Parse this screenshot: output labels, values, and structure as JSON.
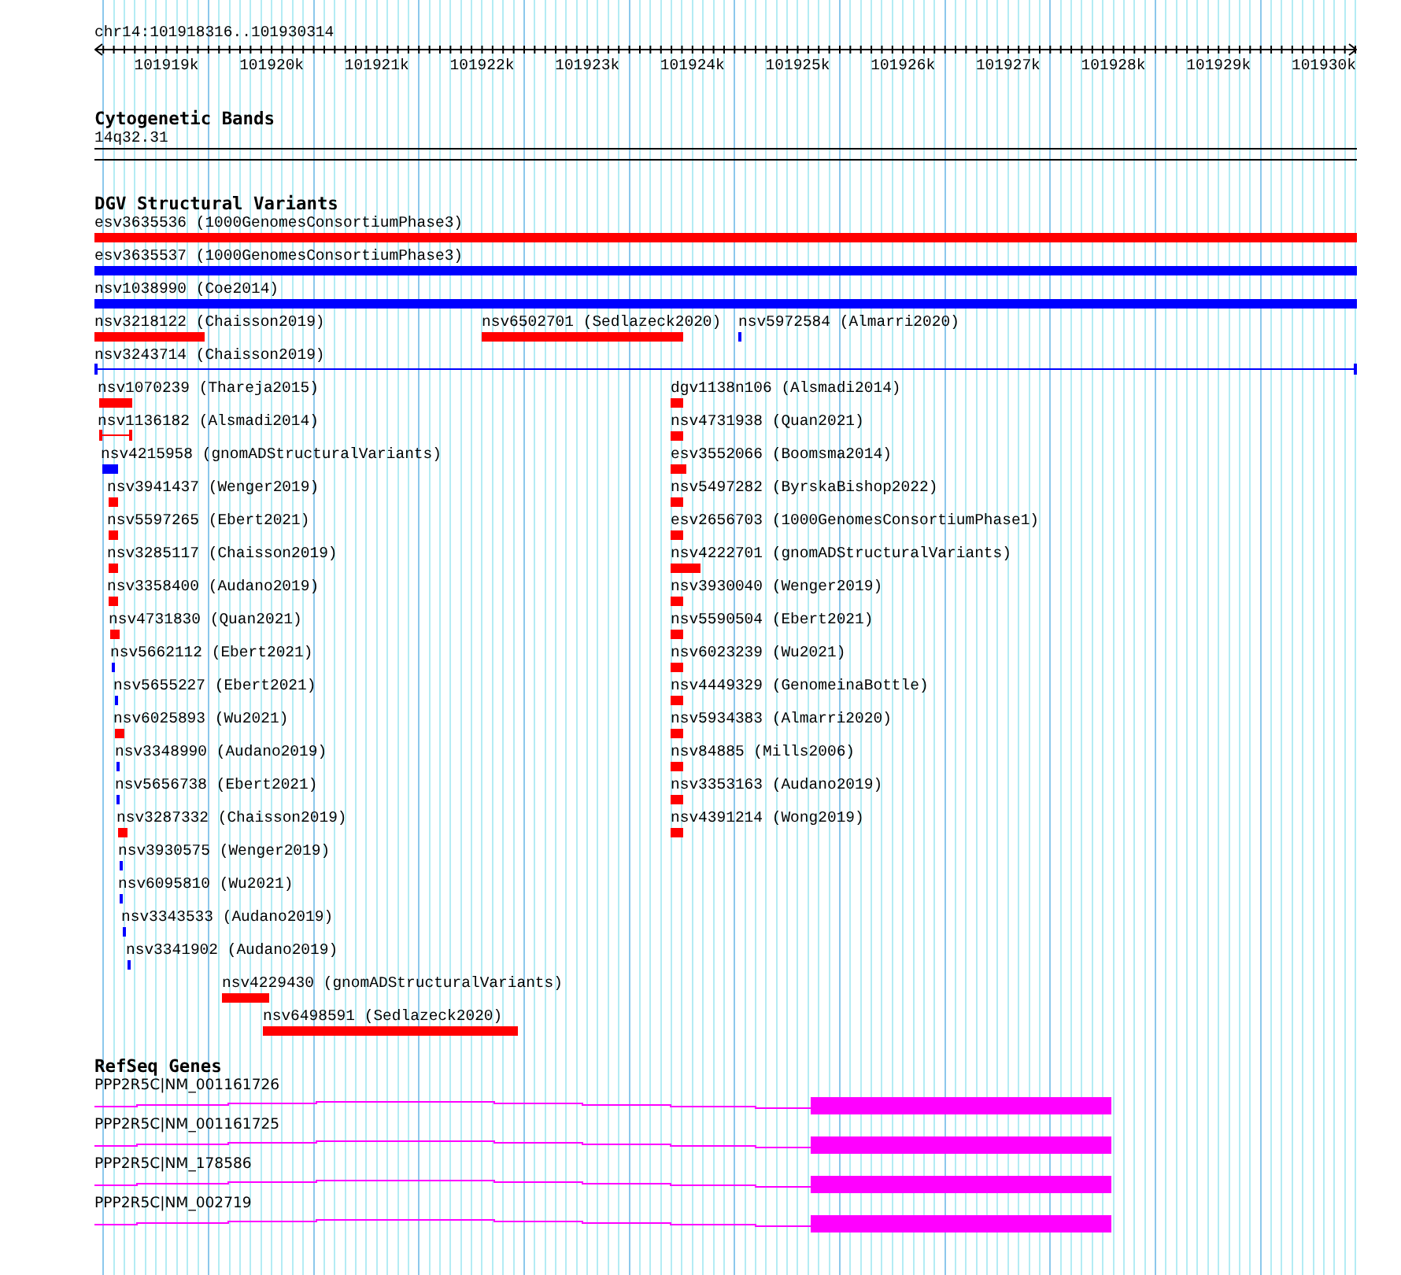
{
  "location": "chr14:101918316..101930314",
  "ruler": {
    "ticks": [
      "101919k",
      "101920k",
      "101921k",
      "101922k",
      "101923k",
      "101924k",
      "101925k",
      "101926k",
      "101927k",
      "101928k",
      "101929k",
      "101930k"
    ]
  },
  "tracks": [
    {
      "kind": "bands",
      "title": "Cytogenetic Bands",
      "features": [
        {
          "label": "14q32.31"
        }
      ]
    },
    {
      "kind": "variants",
      "title": "DGV Structural Variants",
      "features": [
        {
          "label": "esv3635536 (1000GenomesConsortiumPhase3)",
          "color": "#ff0000",
          "kind": "bar"
        },
        {
          "label": "esv3635537 (1000GenomesConsortiumPhase3)",
          "color": "#0000ff",
          "kind": "bar"
        },
        {
          "label": "nsv1038990 (Coe2014)",
          "color": "#0000ff",
          "kind": "bar"
        },
        {
          "label": "nsv3218122 (Chaisson2019)",
          "color": "#ff0000",
          "kind": "bar"
        },
        {
          "label": "nsv6502701 (Sedlazeck2020)",
          "color": "#ff0000",
          "kind": "bar"
        },
        {
          "label": "nsv5972584 (Almarri2020)",
          "color": "#0000ff",
          "kind": "bar"
        },
        {
          "label": "nsv3243714 (Chaisson2019)",
          "color": "#0000ff",
          "kind": "span"
        },
        {
          "label": "nsv1070239 (Thareja2015)",
          "color": "#ff0000",
          "kind": "bar"
        },
        {
          "label": "nsv1136182 (Alsmadi2014)",
          "color": "#ff0000",
          "kind": "span"
        },
        {
          "label": "nsv4215958 (gnomADStructuralVariants)",
          "color": "#0000ff",
          "kind": "bar"
        },
        {
          "label": "nsv3941437 (Wenger2019)",
          "color": "#ff0000",
          "kind": "bar"
        },
        {
          "label": "nsv5597265 (Ebert2021)",
          "color": "#ff0000",
          "kind": "bar"
        },
        {
          "label": "nsv3285117 (Chaisson2019)",
          "color": "#ff0000",
          "kind": "bar"
        },
        {
          "label": "nsv3358400 (Audano2019)",
          "color": "#ff0000",
          "kind": "bar"
        },
        {
          "label": "nsv4731830 (Quan2021)",
          "color": "#ff0000",
          "kind": "bar"
        },
        {
          "label": "nsv5662112 (Ebert2021)",
          "color": "#0000ff",
          "kind": "bar"
        },
        {
          "label": "nsv5655227 (Ebert2021)",
          "color": "#0000ff",
          "kind": "bar"
        },
        {
          "label": "nsv6025893 (Wu2021)",
          "color": "#ff0000",
          "kind": "bar"
        },
        {
          "label": "nsv3348990 (Audano2019)",
          "color": "#0000ff",
          "kind": "bar"
        },
        {
          "label": "nsv5656738 (Ebert2021)",
          "color": "#0000ff",
          "kind": "bar"
        },
        {
          "label": "nsv3287332 (Chaisson2019)",
          "color": "#ff0000",
          "kind": "bar"
        },
        {
          "label": "nsv3930575 (Wenger2019)",
          "color": "#0000ff",
          "kind": "bar"
        },
        {
          "label": "nsv6095810 (Wu2021)",
          "color": "#0000ff",
          "kind": "bar"
        },
        {
          "label": "nsv3343533 (Audano2019)",
          "color": "#0000ff",
          "kind": "bar"
        },
        {
          "label": "nsv3341902 (Audano2019)",
          "color": "#0000ff",
          "kind": "bar"
        },
        {
          "label": "nsv4229430 (gnomADStructuralVariants)",
          "color": "#ff0000",
          "kind": "bar"
        },
        {
          "label": "nsv6498591 (Sedlazeck2020)",
          "color": "#ff0000",
          "kind": "bar"
        },
        {
          "label": "dgv1138n106 (Alsmadi2014)",
          "color": "#ff0000",
          "kind": "bar"
        },
        {
          "label": "nsv4731938 (Quan2021)",
          "color": "#ff0000",
          "kind": "bar"
        },
        {
          "label": "esv3552066 (Boomsma2014)",
          "color": "#ff0000",
          "kind": "bar"
        },
        {
          "label": "nsv5497282 (ByrskaBishop2022)",
          "color": "#ff0000",
          "kind": "bar"
        },
        {
          "label": "esv2656703 (1000GenomesConsortiumPhase1)",
          "color": "#ff0000",
          "kind": "bar"
        },
        {
          "label": "nsv4222701 (gnomADStructuralVariants)",
          "color": "#ff0000",
          "kind": "bar"
        },
        {
          "label": "nsv3930040 (Wenger2019)",
          "color": "#ff0000",
          "kind": "bar"
        },
        {
          "label": "nsv5590504 (Ebert2021)",
          "color": "#ff0000",
          "kind": "bar"
        },
        {
          "label": "nsv6023239 (Wu2021)",
          "color": "#ff0000",
          "kind": "bar"
        },
        {
          "label": "nsv4449329 (GenomeinaBottle)",
          "color": "#ff0000",
          "kind": "bar"
        },
        {
          "label": "nsv5934383 (Almarri2020)",
          "color": "#ff0000",
          "kind": "bar"
        },
        {
          "label": "nsv84885 (Mills2006)",
          "color": "#ff0000",
          "kind": "bar"
        },
        {
          "label": "nsv3353163 (Audano2019)",
          "color": "#ff0000",
          "kind": "bar"
        },
        {
          "label": "nsv4391214 (Wong2019)",
          "color": "#ff0000",
          "kind": "bar"
        }
      ]
    },
    {
      "kind": "genes",
      "title": "RefSeq Genes",
      "features": [
        {
          "label": "PPP2R5C|NM_001161726"
        },
        {
          "label": "PPP2R5C|NM_001161725"
        },
        {
          "label": "PPP2R5C|NM_178586"
        },
        {
          "label": "PPP2R5C|NM_002719"
        }
      ]
    }
  ]
}
